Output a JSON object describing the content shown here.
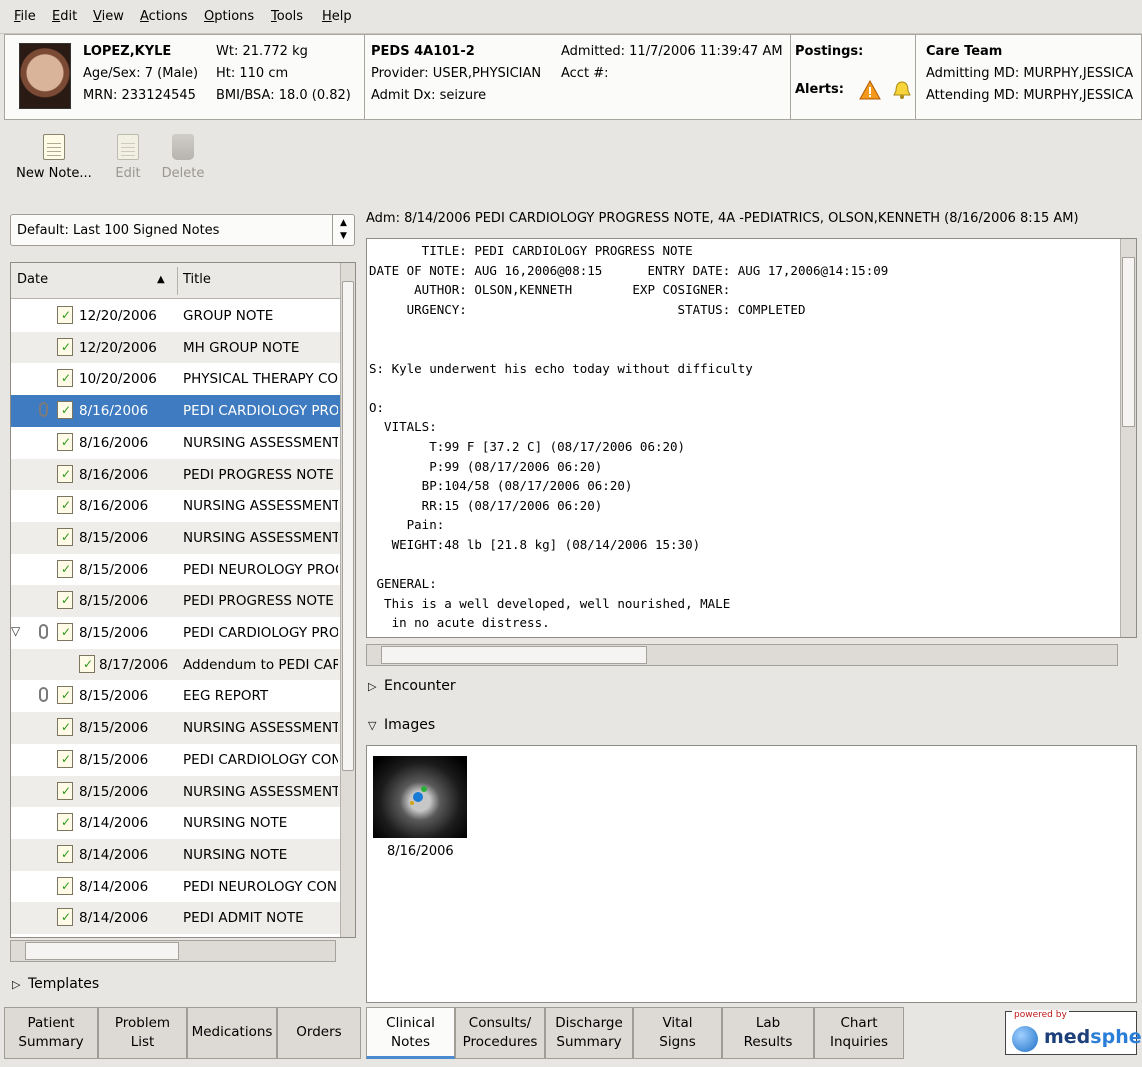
{
  "menu": [
    "File",
    "Edit",
    "View",
    "Actions",
    "Options",
    "Tools",
    "Help"
  ],
  "patient": {
    "name": "LOPEZ,KYLE",
    "age_sex": "Age/Sex: 7 (Male)",
    "mrn": "MRN: 233124545",
    "wt": "Wt: 21.772 kg",
    "ht": "Ht: 110 cm",
    "bmi": "BMI/BSA: 18.0 (0.82)"
  },
  "location": {
    "unit": "PEDS 4A101-2",
    "provider": "Provider: USER,PHYSICIAN",
    "admit_dx": "Admit Dx: seizure",
    "admitted": "Admitted: 11/7/2006 11:39:47 AM",
    "acct": "Acct #:"
  },
  "postings": {
    "postings_label": "Postings:",
    "alerts_label": "Alerts:"
  },
  "care_team": {
    "title": "Care Team",
    "admitting": "Admitting MD: MURPHY,JESSICA",
    "attending": "Attending MD: MURPHY,JESSICA"
  },
  "toolbar": {
    "new_note": "New Note...",
    "edit": "Edit",
    "delete": "Delete"
  },
  "filter": {
    "selected": "Default: Last 100 Signed Notes"
  },
  "list": {
    "col_date": "Date",
    "col_title": "Title",
    "rows": [
      {
        "date": "12/20/2006",
        "title": "GROUP NOTE"
      },
      {
        "date": "12/20/2006",
        "title": "MH GROUP NOTE"
      },
      {
        "date": "10/20/2006",
        "title": "PHYSICAL THERAPY CON"
      },
      {
        "date": "8/16/2006",
        "title": "PEDI CARDIOLOGY PROG"
      },
      {
        "date": "8/16/2006",
        "title": "NURSING ASSESSMENT"
      },
      {
        "date": "8/16/2006",
        "title": "PEDI PROGRESS NOTE"
      },
      {
        "date": "8/16/2006",
        "title": "NURSING ASSESSMENT"
      },
      {
        "date": "8/15/2006",
        "title": "NURSING ASSESSMENT"
      },
      {
        "date": "8/15/2006",
        "title": "PEDI NEUROLOGY PROG"
      },
      {
        "date": "8/15/2006",
        "title": "PEDI PROGRESS NOTE"
      },
      {
        "date": "8/15/2006",
        "title": "PEDI CARDIOLOGY PROG"
      },
      {
        "date": "8/17/2006",
        "title": "Addendum to PEDI CARI"
      },
      {
        "date": "8/15/2006",
        "title": "EEG REPORT"
      },
      {
        "date": "8/15/2006",
        "title": "NURSING ASSESSMENT"
      },
      {
        "date": "8/15/2006",
        "title": "PEDI CARDIOLOGY CON"
      },
      {
        "date": "8/15/2006",
        "title": "NURSING ASSESSMENT"
      },
      {
        "date": "8/14/2006",
        "title": "NURSING NOTE"
      },
      {
        "date": "8/14/2006",
        "title": "NURSING NOTE"
      },
      {
        "date": "8/14/2006",
        "title": "PEDI NEUROLOGY CONS"
      },
      {
        "date": "8/14/2006",
        "title": "PEDI ADMIT NOTE"
      }
    ]
  },
  "templates_label": "Templates",
  "note": {
    "header": "Adm: 8/14/2006 PEDI CARDIOLOGY PROGRESS NOTE, 4A -PEDIATRICS, OLSON,KENNETH (8/16/2006 8:15 AM)",
    "body": "       TITLE: PEDI CARDIOLOGY PROGRESS NOTE\nDATE OF NOTE: AUG 16,2006@08:15      ENTRY DATE: AUG 17,2006@14:15:09\n      AUTHOR: OLSON,KENNETH        EXP COSIGNER:\n     URGENCY:                            STATUS: COMPLETED\n\n\nS: Kyle underwent his echo today without difficulty\n\nO:\n  VITALS:\n        T:99 F [37.2 C] (08/17/2006 06:20)\n        P:99 (08/17/2006 06:20)\n       BP:104/58 (08/17/2006 06:20)\n       RR:15 (08/17/2006 06:20)\n     Pain:\n   WEIGHT:48 lb [21.8 kg] (08/14/2006 15:30)\n\n GENERAL:\n  This is a well developed, well nourished, MALE\n   in no acute distress."
  },
  "encounter_label": "Encounter",
  "images_label": "Images",
  "image_date": "8/16/2006",
  "tabs": {
    "patient_summary": [
      "Patient",
      "Summary"
    ],
    "problem_list": [
      "Problem",
      "List"
    ],
    "medications": "Medications",
    "orders": "Orders",
    "clinical_notes": [
      "Clinical",
      "Notes"
    ],
    "consults": [
      "Consults/",
      "Procedures"
    ],
    "discharge": [
      "Discharge",
      "Summary"
    ],
    "vital_signs": [
      "Vital",
      "Signs"
    ],
    "lab_results": [
      "Lab",
      "Results"
    ],
    "chart_inquiries": [
      "Chart",
      "Inquiries"
    ]
  },
  "logo": {
    "powered_by": "powered by",
    "brand_a": "med",
    "brand_b": "sphere"
  }
}
